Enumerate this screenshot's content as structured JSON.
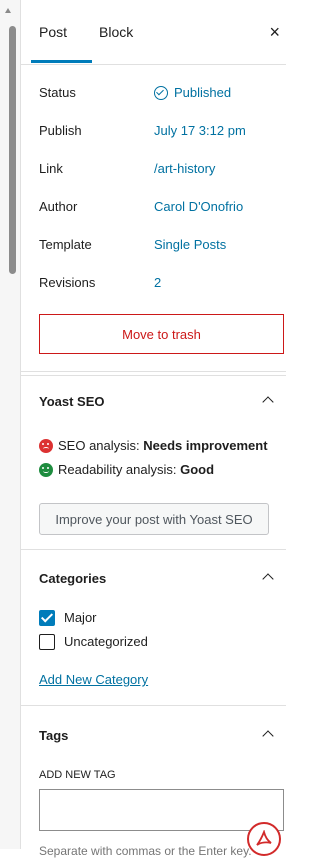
{
  "tabs": {
    "post": "Post",
    "block": "Block",
    "close": "×"
  },
  "summary": {
    "status_label": "Status",
    "status_value": "Published",
    "publish_label": "Publish",
    "publish_value": "July 17 3:12 pm",
    "link_label": "Link",
    "link_value": "/art-history",
    "author_label": "Author",
    "author_value": "Carol D'Onofrio",
    "template_label": "Template",
    "template_value": "Single Posts",
    "revisions_label": "Revisions",
    "revisions_value": "2",
    "trash_label": "Move to trash"
  },
  "yoast": {
    "title": "Yoast SEO",
    "seo_prefix": "SEO analysis: ",
    "seo_value": "Needs improvement",
    "read_prefix": "Readability analysis: ",
    "read_value": "Good",
    "button": "Improve your post with Yoast SEO"
  },
  "categories": {
    "title": "Categories",
    "items": [
      {
        "label": "Major",
        "checked": true
      },
      {
        "label": "Uncategorized",
        "checked": false
      }
    ],
    "add_link": "Add New Category"
  },
  "tags": {
    "title": "Tags",
    "add_label": "ADD NEW TAG",
    "help": "Separate with commas or the Enter key."
  },
  "colors": {
    "accent": "#007cba",
    "link": "#0071a1",
    "danger": "#cc1818"
  }
}
